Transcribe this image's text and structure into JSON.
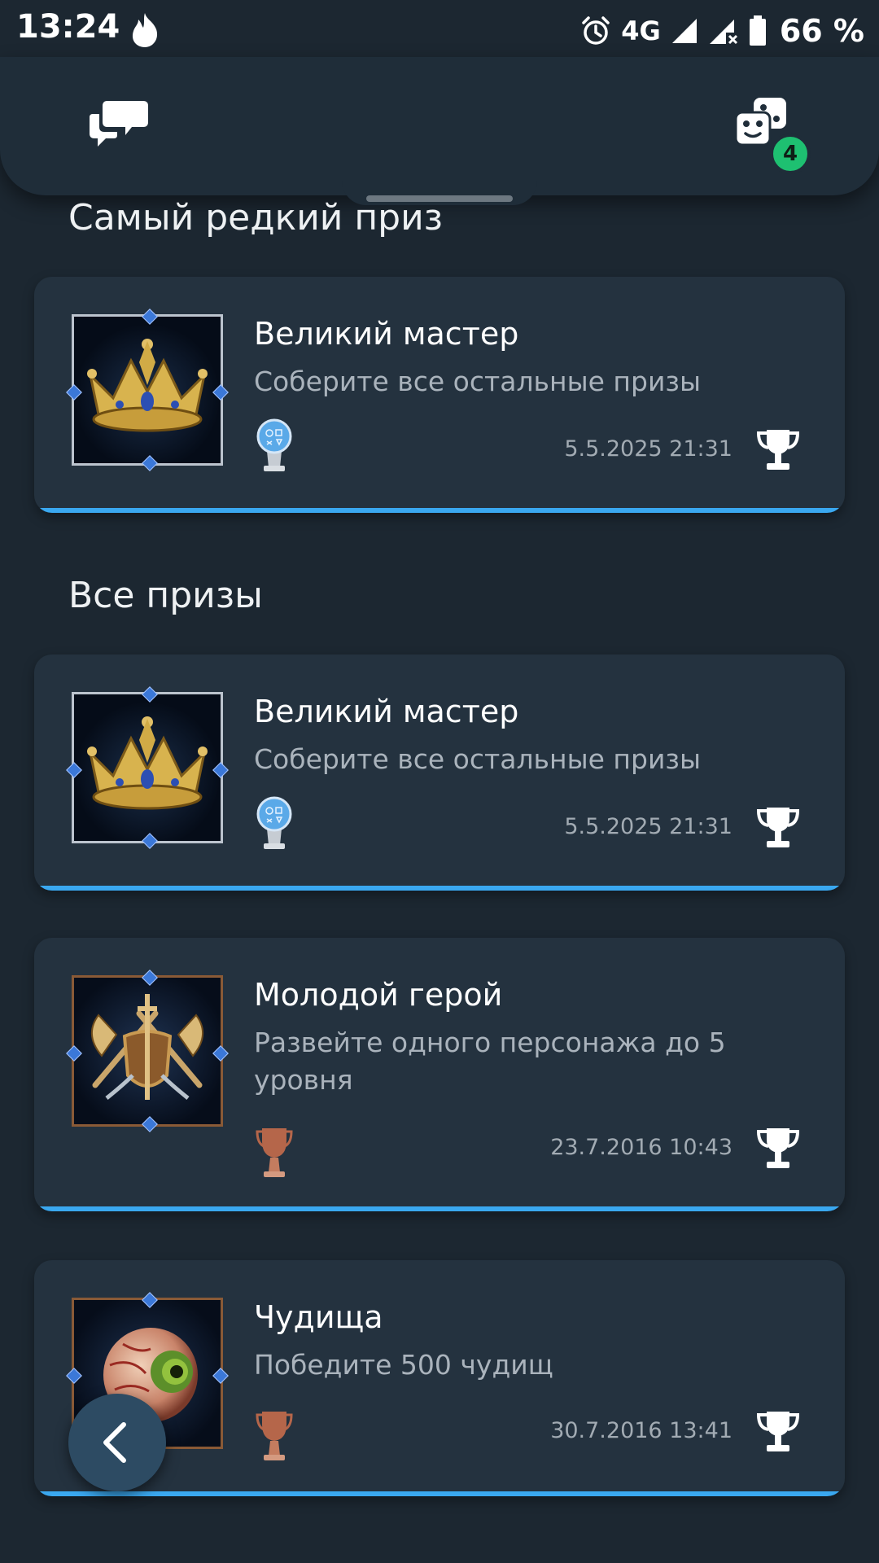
{
  "status_bar": {
    "time": "13:24",
    "network": "4G",
    "battery": "66 %",
    "icons": [
      "flame-icon",
      "alarm-icon",
      "signal-icon",
      "signal-no-data-icon",
      "battery-icon"
    ]
  },
  "header": {
    "left_icon": "chat-icon",
    "right_icon": "dice-icon",
    "badge_count": "4"
  },
  "sections": {
    "rarest": "Самый редкий приз",
    "all": "Все призы"
  },
  "rarest_trophy": {
    "name": "Великий мастер",
    "description": "Соберите все остальные призы",
    "date": "5.5.2025  21:31",
    "grade": "platinum",
    "icon": "crown-icon"
  },
  "trophies": [
    {
      "name": "Великий мастер",
      "description": "Соберите все остальные призы",
      "date": "5.5.2025  21:31",
      "grade": "platinum",
      "icon": "crown-icon"
    },
    {
      "name": "Молодой герой",
      "description": "Развейте одного персонажа до 5 уровня",
      "date": "23.7.2016  10:43",
      "grade": "bronze",
      "icon": "weapons-shield-icon"
    },
    {
      "name": "Чудища",
      "description": "Победите 500 чудищ",
      "date": "30.7.2016  13:41",
      "grade": "bronze",
      "icon": "monster-eye-icon"
    }
  ],
  "colors": {
    "background": "#1c2731",
    "card": "#24323f",
    "accent_line": "#3aa8f0",
    "badge": "#1ec071",
    "fab": "#2d4b63"
  }
}
